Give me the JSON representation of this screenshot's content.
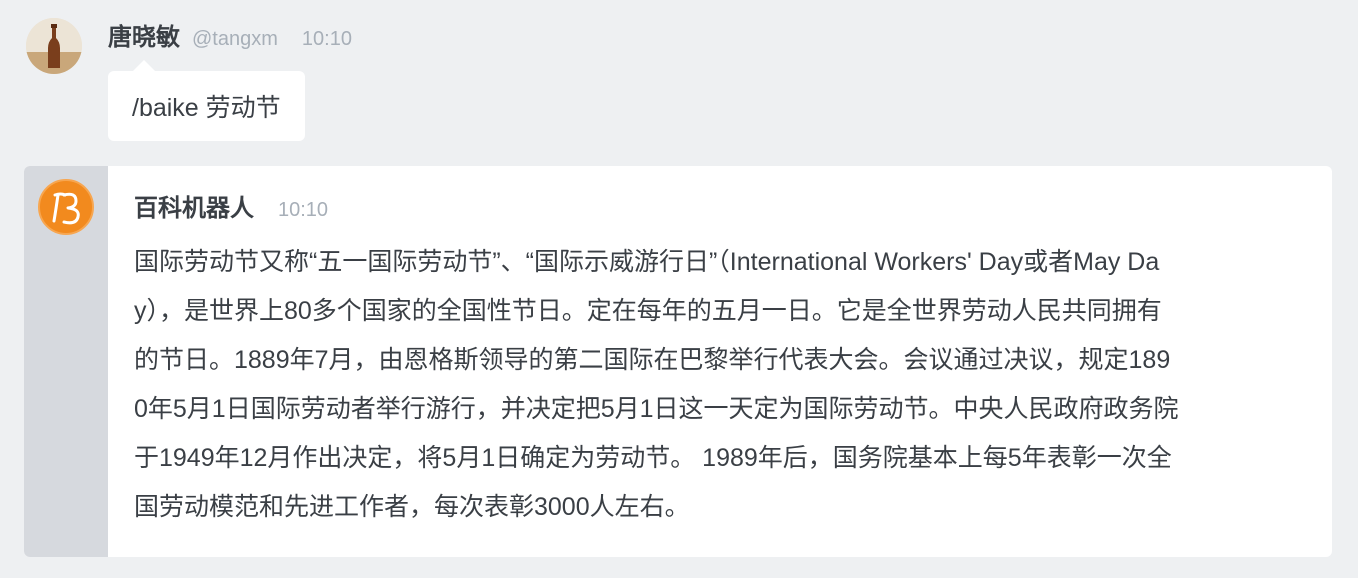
{
  "user_message": {
    "sender_name": "唐晓敏",
    "sender_handle": "@tangxm",
    "time": "10:10",
    "text": "/baike 劳动节"
  },
  "bot_message": {
    "sender_name": "百科机器人",
    "time": "10:10",
    "lines": [
      "国际劳动节又称“五一国际劳动节”、“国际示威游行日”（International Workers' Day或者May Da",
      "y），是世界上80多个国家的全国性节日。定在每年的五月一日。它是全世界劳动人民共同拥有",
      "的节日。1889年7月，由恩格斯领导的第二国际在巴黎举行代表大会。会议通过决议，规定189",
      "0年5月1日国际劳动者举行游行，并决定把5月1日这一天定为国际劳动节。中央人民政府政务院",
      "于1949年12月作出决定，将5月1日确定为劳动节。 1989年后，国务院基本上每5年表彰一次全",
      "国劳动模范和先进工作者，每次表彰3000人左右。"
    ]
  },
  "colors": {
    "background": "#eef0f2",
    "card": "#ffffff",
    "stripe": "#d6d9de",
    "text": "#3a3f45",
    "muted": "#a7afb8",
    "bot_avatar": "#f28a1e"
  },
  "icons": {
    "user_avatar": "bottle-photo-avatar",
    "bot_avatar": "baike-logo-avatar"
  }
}
